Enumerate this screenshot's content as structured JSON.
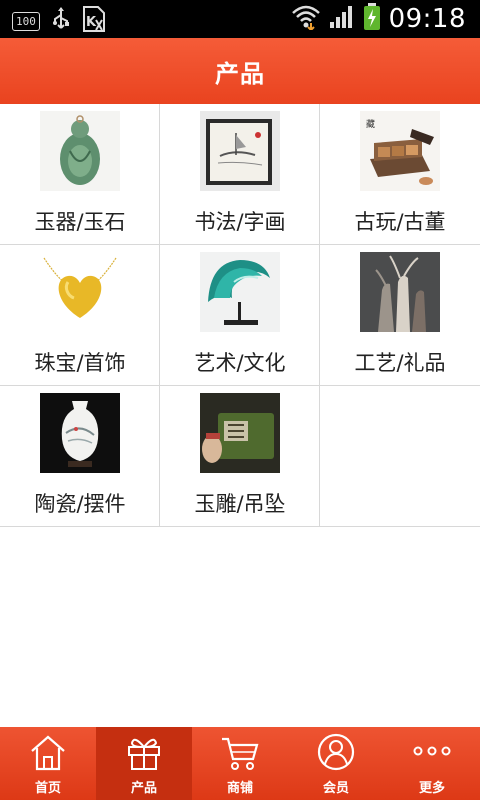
{
  "status_bar": {
    "battery_level": "100",
    "time": "09:18"
  },
  "header": {
    "title": "产品"
  },
  "categories": [
    {
      "label": "玉器/玉石",
      "image": "jade-pendant"
    },
    {
      "label": "书法/字画",
      "image": "framed-painting"
    },
    {
      "label": "古玩/古董",
      "image": "antique-box"
    },
    {
      "label": "珠宝/首饰",
      "image": "gold-heart-necklace"
    },
    {
      "label": "艺术/文化",
      "image": "glass-wave-sculpture"
    },
    {
      "label": "工艺/礼品",
      "image": "deer-figurines"
    },
    {
      "label": "陶瓷/摆件",
      "image": "porcelain-vase"
    },
    {
      "label": "玉雕/吊坠",
      "image": "jade-seal"
    }
  ],
  "bottom_nav": {
    "items": [
      {
        "label": "首页",
        "icon": "home-icon",
        "active": false
      },
      {
        "label": "产品",
        "icon": "gift-icon",
        "active": true
      },
      {
        "label": "商铺",
        "icon": "cart-icon",
        "active": false
      },
      {
        "label": "会员",
        "icon": "member-icon",
        "active": false
      },
      {
        "label": "更多",
        "icon": "more-icon",
        "active": false
      }
    ]
  },
  "colors": {
    "accent": "#e9431f",
    "status_bar": "#000000",
    "grid_line": "#d8d8d8"
  }
}
